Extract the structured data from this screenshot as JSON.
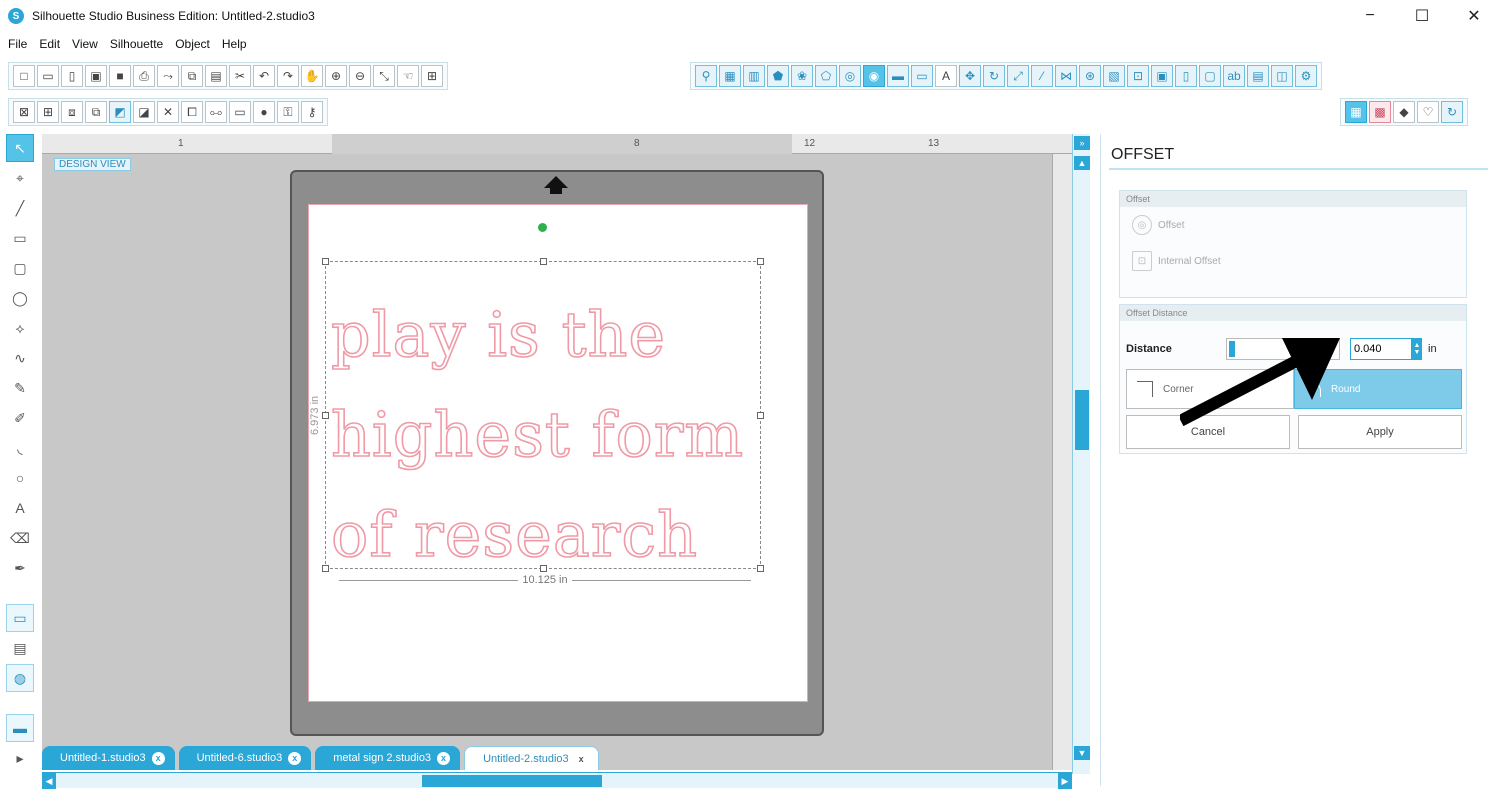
{
  "window": {
    "title": "Silhouette Studio Business Edition: Untitled-2.studio3",
    "minimize": "−",
    "maximize": "☐",
    "close": "✕"
  },
  "menu": [
    "File",
    "Edit",
    "View",
    "Silhouette",
    "Object",
    "Help"
  ],
  "toolbar1": {
    "left_icons": [
      "new-icon",
      "open-icon",
      "template-icon",
      "save-icon",
      "save-as-icon",
      "print-icon",
      "send-icon",
      "copy-icon",
      "paste-icon",
      "cut-icon",
      "undo-icon",
      "redo-icon",
      "pan-icon",
      "zoom-in-icon",
      "zoom-out-icon",
      "zoom-select-icon",
      "hand-icon",
      "fit-icon"
    ],
    "right_icons": [
      "page-settings-icon",
      "grid-icon",
      "align-icon",
      "fill-icon",
      "line-icon",
      "gradient-icon",
      "pattern-icon",
      "sketch-icon",
      "offset-icon",
      "replicate-icon",
      "modify-icon",
      "text-style-icon",
      "transform-icon",
      "rotate-icon",
      "scale-icon",
      "knife-icon",
      "weld-icon",
      "trace-icon",
      "library-icon",
      "store-icon",
      "design-store-icon",
      "print-cut-icon",
      "media-icon",
      "text-icon",
      "layers-icon",
      "send-panel-icon",
      "settings-icon"
    ]
  },
  "toolbar2": {
    "left_icons": [
      "group-icon",
      "ungroup-icon",
      "compound-icon",
      "release-icon",
      "bring-forward-icon",
      "send-back-icon",
      "delete-icon",
      "duplicate-icon",
      "mirror-icon",
      "flip-icon",
      "circle-icon",
      "lock-icon",
      "unlock-icon"
    ],
    "right_icons": [
      "design-view-icon",
      "send-view-icon",
      "eraser-icon",
      "heart-icon",
      "refresh-icon"
    ]
  },
  "left_tools": [
    "select-icon",
    "point-edit-icon",
    "line-icon",
    "rectangle-icon",
    "rounded-rect-icon",
    "ellipse-icon",
    "polygon-icon",
    "curve-icon",
    "freehand-icon",
    "smooth-icon",
    "arc-icon",
    "circle-icon",
    "text-tool-icon",
    "eraser-icon",
    "knife-icon"
  ],
  "ruler": {
    "ticks": [
      "1",
      "8",
      "12",
      "13"
    ]
  },
  "canvas": {
    "design_view_label": "DESIGN VIEW",
    "text_lines": [
      "play is the",
      "highest form",
      "of research"
    ],
    "width_dim": "10.125 in",
    "height_dim": "6.973 in"
  },
  "tabs": [
    {
      "label": "Untitled-1.studio3",
      "close": "x",
      "active": false
    },
    {
      "label": "Untitled-6.studio3",
      "close": "x",
      "active": false
    },
    {
      "label": "metal sign 2.studio3",
      "close": "x",
      "active": false
    },
    {
      "label": "Untitled-2.studio3",
      "close": "x",
      "active": true
    }
  ],
  "panel": {
    "title": "OFFSET",
    "offset_section": "Offset",
    "offset_option": "Offset",
    "internal_offset_option": "Internal Offset",
    "distance_section": "Offset Distance",
    "distance_label": "Distance",
    "distance_value": "0.040",
    "unit": "in",
    "corner_label": "Corner",
    "round_label": "Round",
    "cancel_label": "Cancel",
    "apply_label": "Apply"
  },
  "colors": {
    "accent": "#2aa7d6",
    "text_outline": "#f09aa6",
    "mat": "#8d8d8d",
    "workspace": "#c8c8c8"
  }
}
